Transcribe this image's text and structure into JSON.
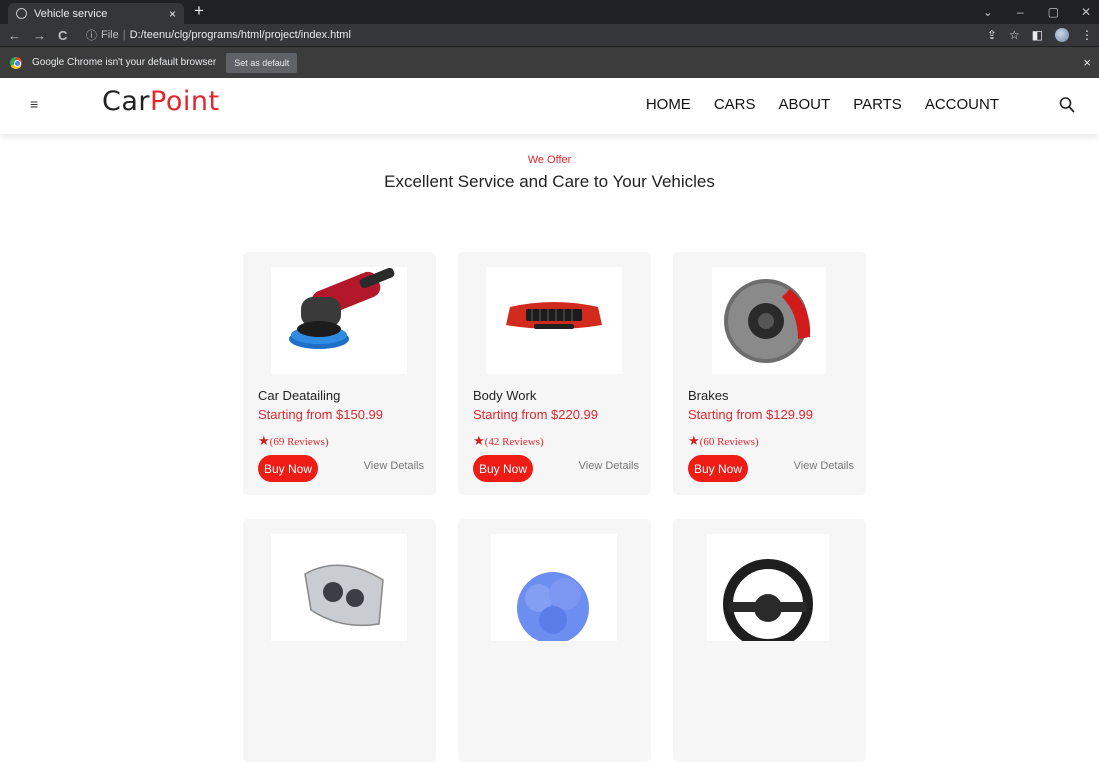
{
  "browser": {
    "tab_title": "Vehicle service",
    "tab_close": "×",
    "new_tab": "+",
    "url_file_label": "File",
    "url_separator": "|",
    "url_path": "D:/teenu/clg/programs/html/project/index.html",
    "infobar_message": "Google Chrome isn't your default browser",
    "set_default_label": "Set as default",
    "infobar_close": "×",
    "icons": [
      "back-icon",
      "forward-icon",
      "reload-icon",
      "info-icon",
      "share-icon",
      "bookmark-star-icon",
      "sidepanel-icon",
      "profile-avatar-icon",
      "more-menu-icon"
    ]
  },
  "site": {
    "logo_part1": "Car",
    "logo_part2": "Point",
    "nav": [
      "HOME",
      "CARS",
      "ABOUT",
      "PARTS",
      "ACCOUNT"
    ],
    "menu_icon": "hamburger-menu-icon",
    "search_icon": "search-icon"
  },
  "intro": {
    "eyebrow": "We Offer",
    "headline": "Excellent Service and Care to Your Vehicles"
  },
  "cards": [
    {
      "title": "Car Deatailing",
      "price": "Starting from $150.99",
      "reviews": "(69  Reviews)",
      "buy": "Buy Now",
      "details": "View Details",
      "image": "polisher"
    },
    {
      "title": "Body Work",
      "price": "Starting from $220.99",
      "reviews": "(42  Reviews)",
      "buy": "Buy Now",
      "details": "View Details",
      "image": "bumper"
    },
    {
      "title": "Brakes",
      "price": "Starting from $129.99",
      "reviews": "(60  Reviews)",
      "buy": "Buy Now",
      "details": "View Details",
      "image": "brake-disc"
    },
    {
      "title": "",
      "price": "",
      "reviews": "",
      "buy": "",
      "details": "",
      "image": "headlight"
    },
    {
      "title": "",
      "price": "",
      "reviews": "",
      "buy": "",
      "details": "",
      "image": "sponge"
    },
    {
      "title": "",
      "price": "",
      "reviews": "",
      "buy": "",
      "details": "",
      "image": "steering-wheel"
    }
  ],
  "colors": {
    "accent": "#e4262e",
    "button": "#ef1c16",
    "card_bg": "#f6f6f6",
    "chrome_dark": "#202124"
  }
}
